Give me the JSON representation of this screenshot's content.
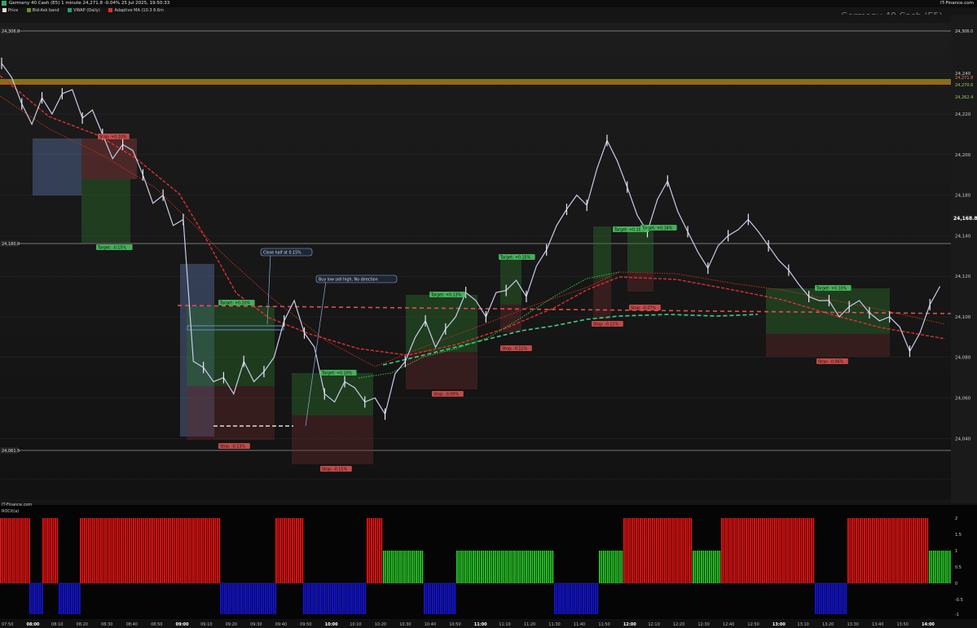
{
  "topbar": {
    "title": "Germany 40 Cash (E5) 1 minute 24,271.8 -0.04% 25 Jul 2025, 19:50:33",
    "brand": "IT-Finance.com"
  },
  "legend": [
    {
      "label": "Price",
      "color": "#dddddd"
    },
    {
      "label": "Bid-Ask band",
      "color": "#6a8f2a"
    },
    {
      "label": "VWAP (Daily)",
      "color": "#2a9d6a"
    },
    {
      "label": "Adaptive MA (10.3 6.6m",
      "color": "#d33"
    }
  ],
  "chart_header": "Germany 40 Cash (E5)",
  "indicator": {
    "source": "IT-Finance.com",
    "label": "ROCit(a)",
    "ticks": [
      "2",
      "1.5",
      "1",
      "0.5",
      "0",
      "-0.5",
      "-1"
    ]
  },
  "chart_data": {
    "type": "line",
    "title": "Germany 40 Cash (E5)",
    "y_ticks": [
      "24,240",
      "24,220",
      "24,200",
      "24,180",
      "24,168.8",
      "24,140",
      "24,120",
      "24,100",
      "24,080",
      "24,060",
      "24,040"
    ],
    "ylim": [
      24030,
      24265
    ],
    "x_ticks": [
      "07:50",
      "08:00",
      "08:10",
      "08:20",
      "08:30",
      "08:40",
      "08:50",
      "09:00",
      "09:10",
      "09:20",
      "09:30",
      "09:40",
      "09:50",
      "10:00",
      "10:10",
      "10:20",
      "10:30",
      "10:40",
      "10:50",
      "11:00",
      "11:10",
      "11:20",
      "11:30",
      "11:40",
      "11:50",
      "12:00",
      "12:10",
      "12:20",
      "12:30",
      "12:40",
      "12:50",
      "13:00",
      "13:10",
      "13:20",
      "13:30",
      "13:40",
      "13:50",
      "14:00"
    ],
    "bold_x_ticks": [
      "08:00",
      "09:00",
      "10:00",
      "11:00",
      "12:00",
      "13:00",
      "14:00"
    ],
    "price_levels": [
      {
        "label": "24,306.0",
        "side": "left"
      },
      {
        "label": "24,180.0",
        "side": "left"
      },
      {
        "label": "24,061.5",
        "side": "left"
      },
      {
        "label": "24,306.0",
        "side": "right"
      },
      {
        "label": "24,271.8",
        "side": "right"
      },
      {
        "label": "24,270.6",
        "side": "right"
      },
      {
        "label": "24,262.4",
        "side": "right"
      },
      {
        "label": "24,168.8",
        "side": "right"
      }
    ],
    "price_series": [
      [
        0,
        24245
      ],
      [
        3,
        24238
      ],
      [
        6,
        24225
      ],
      [
        9,
        24215
      ],
      [
        12,
        24228
      ],
      [
        15,
        24220
      ],
      [
        18,
        24230
      ],
      [
        21,
        24232
      ],
      [
        24,
        24218
      ],
      [
        27,
        24222
      ],
      [
        30,
        24210
      ],
      [
        33,
        24198
      ],
      [
        36,
        24205
      ],
      [
        39,
        24202
      ],
      [
        42,
        24190
      ],
      [
        45,
        24176
      ],
      [
        48,
        24180
      ],
      [
        51,
        24165
      ],
      [
        54,
        24168
      ],
      [
        57,
        24098
      ],
      [
        60,
        24095
      ],
      [
        63,
        24088
      ],
      [
        66,
        24090
      ],
      [
        69,
        24082
      ],
      [
        72,
        24098
      ],
      [
        75,
        24088
      ],
      [
        78,
        24093
      ],
      [
        81,
        24100
      ],
      [
        84,
        24118
      ],
      [
        87,
        24128
      ],
      [
        90,
        24112
      ],
      [
        93,
        24105
      ],
      [
        96,
        24082
      ],
      [
        99,
        24078
      ],
      [
        102,
        24088
      ],
      [
        105,
        24085
      ],
      [
        108,
        24078
      ],
      [
        111,
        24080
      ],
      [
        114,
        24072
      ],
      [
        117,
        24092
      ],
      [
        120,
        24098
      ],
      [
        123,
        24110
      ],
      [
        126,
        24118
      ],
      [
        129,
        24105
      ],
      [
        132,
        24114
      ],
      [
        135,
        24120
      ],
      [
        138,
        24132
      ],
      [
        141,
        24128
      ],
      [
        144,
        24120
      ],
      [
        147,
        24132
      ],
      [
        150,
        24133
      ],
      [
        153,
        24138
      ],
      [
        156,
        24130
      ],
      [
        159,
        24145
      ],
      [
        162,
        24153
      ],
      [
        165,
        24165
      ],
      [
        168,
        24173
      ],
      [
        171,
        24180
      ],
      [
        174,
        24175
      ],
      [
        177,
        24193
      ],
      [
        180,
        24207
      ],
      [
        183,
        24197
      ],
      [
        186,
        24184
      ],
      [
        189,
        24170
      ],
      [
        192,
        24162
      ],
      [
        195,
        24178
      ],
      [
        198,
        24187
      ],
      [
        201,
        24172
      ],
      [
        204,
        24162
      ],
      [
        207,
        24152
      ],
      [
        210,
        24144
      ],
      [
        213,
        24155
      ],
      [
        216,
        24160
      ],
      [
        219,
        24163
      ],
      [
        222,
        24168
      ],
      [
        225,
        24162
      ],
      [
        228,
        24155
      ],
      [
        231,
        24148
      ],
      [
        234,
        24143
      ],
      [
        237,
        24136
      ],
      [
        240,
        24130
      ],
      [
        243,
        24128
      ],
      [
        246,
        24128
      ],
      [
        249,
        24120
      ],
      [
        252,
        24125
      ],
      [
        255,
        24128
      ],
      [
        258,
        24122
      ],
      [
        261,
        24118
      ],
      [
        264,
        24120
      ],
      [
        267,
        24115
      ],
      [
        270,
        24103
      ],
      [
        273,
        24112
      ],
      [
        276,
        24126
      ],
      [
        279,
        24135
      ]
    ],
    "trade_markers": [
      {
        "label": "Stop: +0.10%",
        "kind": "stop"
      },
      {
        "label": "Target: -0.15%",
        "kind": "target"
      },
      {
        "label": "Target: +0.20%",
        "kind": "target"
      },
      {
        "label": "Stop: -0.13%",
        "kind": "stop"
      },
      {
        "label": "Target: +0.10%",
        "kind": "target"
      },
      {
        "label": "Stop: -0.11%",
        "kind": "stop"
      },
      {
        "label": "Target: +0.13%",
        "kind": "target"
      },
      {
        "label": "Stop: -0.09%",
        "kind": "stop"
      },
      {
        "label": "Target: +0.15%",
        "kind": "target"
      },
      {
        "label": "Stop: -0.11%",
        "kind": "stop"
      },
      {
        "label": "Target: +0.10%",
        "kind": "target"
      },
      {
        "label": "Stop: -0.11%",
        "kind": "stop"
      },
      {
        "label": "Target: +0.16%",
        "kind": "target"
      },
      {
        "label": "Stop: -0.07%",
        "kind": "stop"
      },
      {
        "label": "Target: +0.10%",
        "kind": "target"
      },
      {
        "label": "Stop: -0.06%",
        "kind": "stop"
      }
    ],
    "annotations": [
      "Close half at 0.15%",
      "Buy low sell high, No direction"
    ],
    "indicator_series": {
      "name": "ROCit(a)",
      "ylim": [
        -1,
        2
      ]
    }
  }
}
